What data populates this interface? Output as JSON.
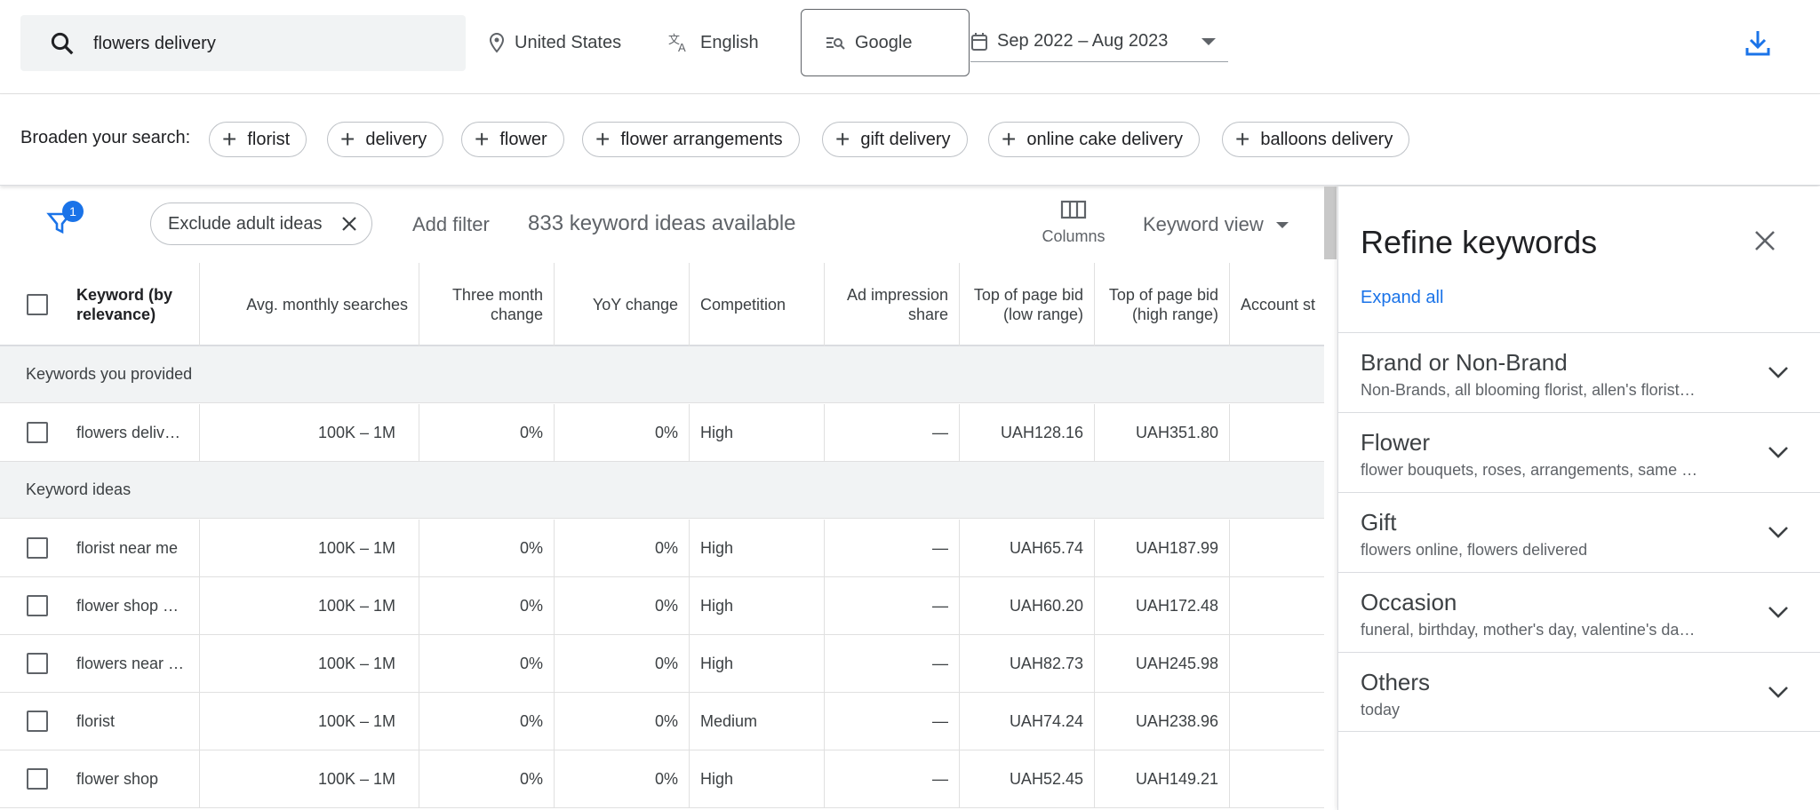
{
  "search": {
    "query": "flowers delivery"
  },
  "top": {
    "location": "United States",
    "language": "English",
    "network": "Google",
    "date_range": "Sep 2022 – Aug 2023"
  },
  "broaden": {
    "label": "Broaden your search:",
    "chips": [
      "florist",
      "delivery",
      "flower",
      "flower arrangements",
      "gift delivery",
      "online cake delivery",
      "balloons delivery"
    ]
  },
  "filters": {
    "badge_count": "1",
    "exclude_chip": "Exclude adult ideas",
    "add_filter": "Add filter",
    "ideas_count": "833 keyword ideas available",
    "columns": "Columns",
    "view": "Keyword view"
  },
  "table": {
    "headers": {
      "keyword": "Keyword (by relevance)",
      "avg": "Avg. monthly searches",
      "three_month": "Three month change",
      "yoy": "YoY change",
      "competition": "Competition",
      "ad_share": "Ad impression share",
      "bid_low": "Top of page bid (low range)",
      "bid_high": "Top of page bid (high range)",
      "account": "Account st"
    },
    "group_provided": "Keywords you provided",
    "provided_rows": [
      {
        "keyword": "flowers deliv…",
        "avg": "100K – 1M",
        "three": "0%",
        "yoy": "0%",
        "comp": "High",
        "share": "—",
        "low": "UAH128.16",
        "high": "UAH351.80"
      }
    ],
    "group_ideas": "Keyword ideas",
    "idea_rows": [
      {
        "keyword": "florist near me",
        "avg": "100K – 1M",
        "three": "0%",
        "yoy": "0%",
        "comp": "High",
        "share": "—",
        "low": "UAH65.74",
        "high": "UAH187.99"
      },
      {
        "keyword": "flower shop …",
        "avg": "100K – 1M",
        "three": "0%",
        "yoy": "0%",
        "comp": "High",
        "share": "—",
        "low": "UAH60.20",
        "high": "UAH172.48"
      },
      {
        "keyword": "flowers near …",
        "avg": "100K – 1M",
        "three": "0%",
        "yoy": "0%",
        "comp": "High",
        "share": "—",
        "low": "UAH82.73",
        "high": "UAH245.98"
      },
      {
        "keyword": "florist",
        "avg": "100K – 1M",
        "three": "0%",
        "yoy": "0%",
        "comp": "Medium",
        "share": "—",
        "low": "UAH74.24",
        "high": "UAH238.96"
      },
      {
        "keyword": "flower shop",
        "avg": "100K – 1M",
        "three": "0%",
        "yoy": "0%",
        "comp": "High",
        "share": "—",
        "low": "UAH52.45",
        "high": "UAH149.21"
      }
    ]
  },
  "panel": {
    "title": "Refine keywords",
    "expand_all": "Expand all",
    "items": [
      {
        "name": "Brand or Non-Brand",
        "desc": "Non-Brands, all blooming florist, allen's florist…"
      },
      {
        "name": "Flower",
        "desc": "flower bouquets, roses, arrangements, same …"
      },
      {
        "name": "Gift",
        "desc": "flowers online, flowers delivered"
      },
      {
        "name": "Occasion",
        "desc": "funeral, birthday, mother's day, valentine's da…"
      },
      {
        "name": "Others",
        "desc": "today"
      }
    ]
  },
  "colors": {
    "accent": "#1a73e8",
    "text": "#202124",
    "muted": "#5f6368"
  }
}
